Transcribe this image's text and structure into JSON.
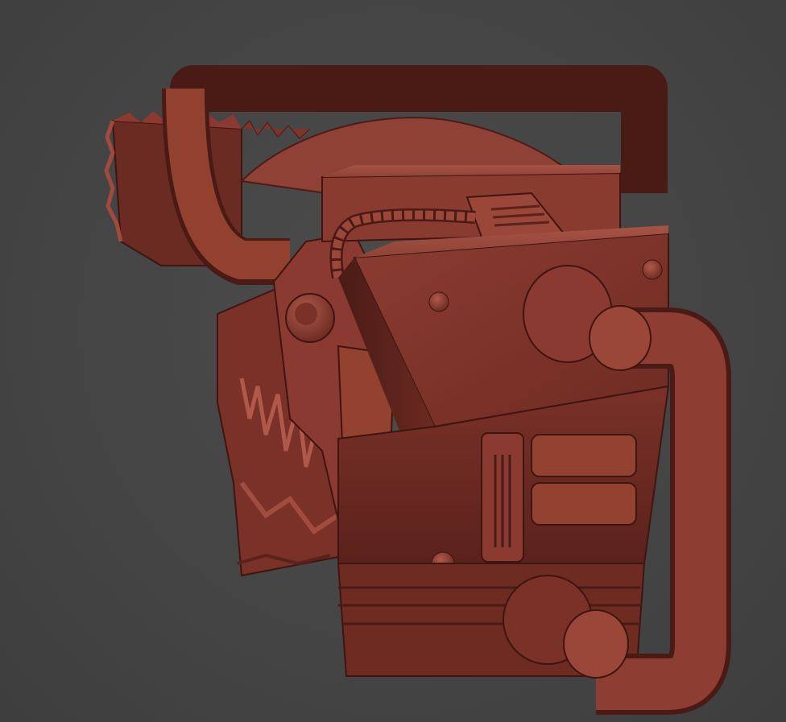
{
  "viewport": {
    "background": "#464646"
  },
  "model": {
    "subject": "chainsaw-head",
    "material_color": "#8a3a30",
    "shadow_color": "#4a1a15",
    "highlight_color": "#b5584a"
  }
}
